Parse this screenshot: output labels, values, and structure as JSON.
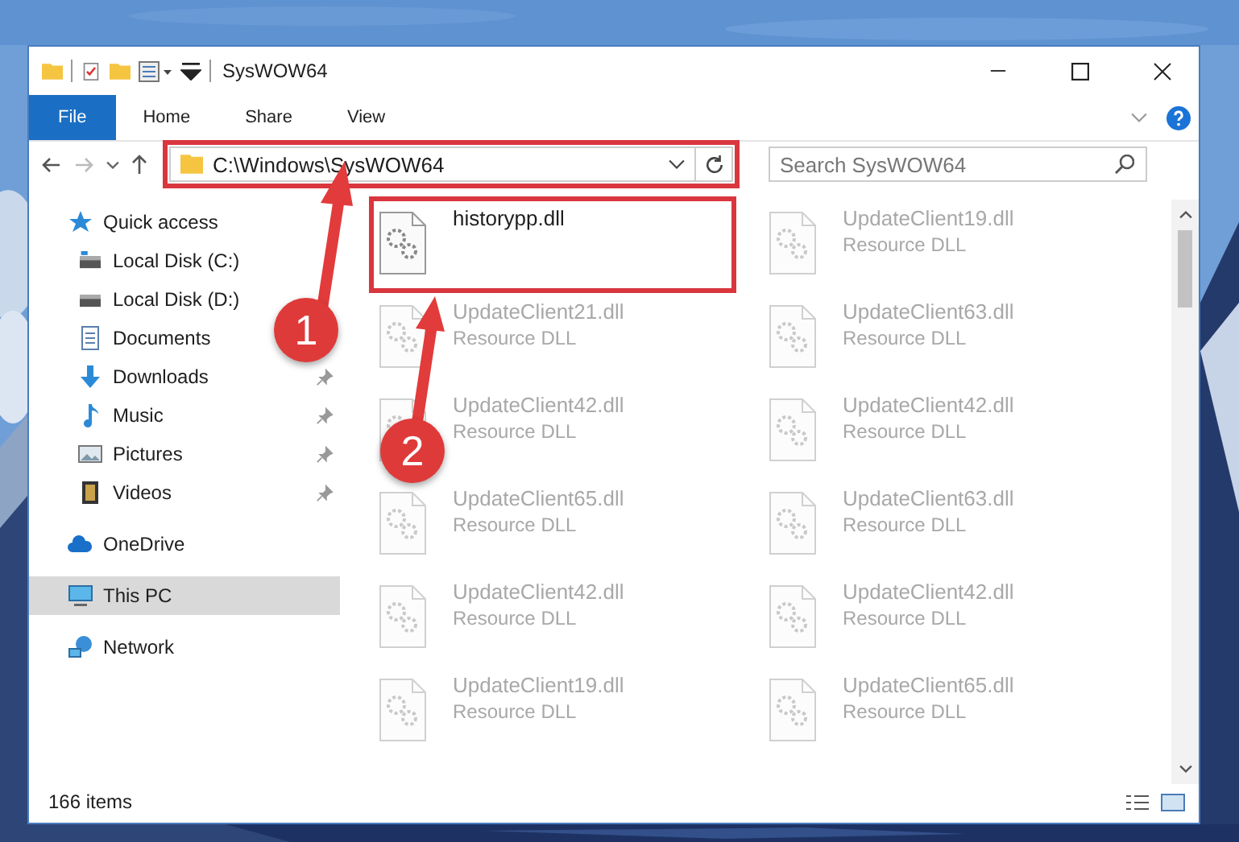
{
  "window": {
    "title": "SysWOW64"
  },
  "ribbon_tabs": [
    {
      "label": "File",
      "selected": true
    },
    {
      "label": "Home",
      "selected": false
    },
    {
      "label": "Share",
      "selected": false
    },
    {
      "label": "View",
      "selected": false
    }
  ],
  "address_bar": {
    "path": "C:\\Windows\\SysWOW64",
    "highlighted": true
  },
  "search": {
    "placeholder": "Search SysWOW64"
  },
  "sidebar": {
    "items": [
      {
        "label": "Quick access",
        "kind": "star",
        "selected": false,
        "children": [
          {
            "label": "Local Disk (C:)",
            "kind": "drive",
            "pinned": false
          },
          {
            "label": "Local Disk (D:)",
            "kind": "drive",
            "pinned": false
          },
          {
            "label": "Documents",
            "kind": "document",
            "pinned": false
          },
          {
            "label": "Downloads",
            "kind": "download",
            "pinned": true
          },
          {
            "label": "Music",
            "kind": "music",
            "pinned": true
          },
          {
            "label": "Pictures",
            "kind": "pictures",
            "pinned": true
          },
          {
            "label": "Videos",
            "kind": "videos",
            "pinned": true
          }
        ]
      },
      {
        "label": "OneDrive",
        "kind": "cloud",
        "selected": false
      },
      {
        "label": "This PC",
        "kind": "pc",
        "selected": true
      },
      {
        "label": "Network",
        "kind": "network",
        "selected": false
      }
    ]
  },
  "files": [
    {
      "name": "historypp.dll",
      "highlighted": true,
      "blurred": false
    },
    {
      "name": "UpdateClient19.dll",
      "type": "Resource DLL",
      "highlighted": false,
      "blurred": true
    },
    {
      "name": "UpdateClient21.dll",
      "type": "Resource DLL",
      "highlighted": false,
      "blurred": true
    },
    {
      "name": "UpdateClient63.dll",
      "type": "Resource DLL",
      "highlighted": false,
      "blurred": true
    },
    {
      "name": "UpdateClient42.dll",
      "type": "Resource DLL",
      "highlighted": false,
      "blurred": true
    },
    {
      "name": "UpdateClient42.dll",
      "type": "Resource DLL",
      "highlighted": false,
      "blurred": true
    },
    {
      "name": "UpdateClient65.dll",
      "type": "Resource DLL",
      "highlighted": false,
      "blurred": true
    },
    {
      "name": "UpdateClient63.dll",
      "type": "Resource DLL",
      "highlighted": false,
      "blurred": true
    },
    {
      "name": "UpdateClient42.dll",
      "type": "Resource DLL",
      "highlighted": false,
      "blurred": true
    },
    {
      "name": "UpdateClient42.dll",
      "type": "Resource DLL",
      "highlighted": false,
      "blurred": true
    },
    {
      "name": "UpdateClient19.dll",
      "type": "Resource DLL",
      "highlighted": false,
      "blurred": true
    },
    {
      "name": "UpdateClient65.dll",
      "type": "Resource DLL",
      "highlighted": false,
      "blurred": true
    }
  ],
  "status_bar": {
    "item_count": "166 items"
  },
  "callouts": [
    {
      "number": "1"
    },
    {
      "number": "2"
    }
  ]
}
